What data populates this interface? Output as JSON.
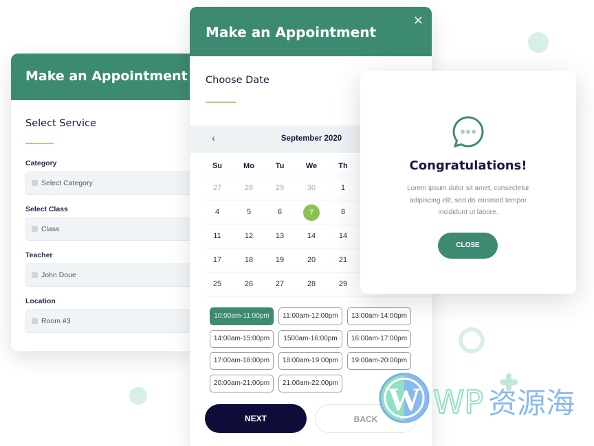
{
  "colors": {
    "primary": "#3d8a72",
    "accent": "#8cc151",
    "dark": "#0f0c3a"
  },
  "service_form": {
    "title": "Make an Appointment",
    "subtitle": "Select Service",
    "fields": [
      {
        "label": "Category",
        "value": "Select Category",
        "icon": "category-icon"
      },
      {
        "label": "Select Class",
        "value": "Class",
        "icon": "class-icon"
      },
      {
        "label": "Teacher",
        "value": "John Doue",
        "icon": "user-icon"
      },
      {
        "label": "Location",
        "value": "Room #3",
        "icon": "location-pin-icon"
      }
    ]
  },
  "date_form": {
    "title": "Make an Appointment",
    "close": "×",
    "subtitle": "Choose Date",
    "prev": "‹",
    "month": "September 2020",
    "weekdays": [
      "Su",
      "Mo",
      "Tu",
      "We",
      "Th"
    ],
    "weeks": [
      [
        "27",
        "28",
        "29",
        "30",
        "1"
      ],
      [
        "4",
        "5",
        "6",
        "7",
        "8"
      ],
      [
        "11",
        "12",
        "13",
        "14",
        "14"
      ],
      [
        "17",
        "18",
        "19",
        "20",
        "21"
      ],
      [
        "25",
        "26",
        "27",
        "28",
        "29"
      ]
    ],
    "selected_day": "7",
    "slots": [
      "10:00am-11:00pm",
      "11:00am-12:00pm",
      "13:00am-14:00pm",
      "14:00am-15:00pm",
      "1500am-16:00pm",
      "16:00am-17:00pm",
      "17:00am-18:00pm",
      "18:00am-19:00pm",
      "19:00am-20:00pm",
      "20:00am-21:00pm",
      "21:00am-22:00pm"
    ],
    "selected_slot": 0,
    "next": "NEXT",
    "back": "BACK"
  },
  "congrats": {
    "title": "Congratulations!",
    "text": "Lorem ipsum dolor sit amet, consectetur adipiscing elit, sed do eiusmod tempor incididunt ut labore.",
    "close": "CLOSE"
  },
  "watermark": "WP资源海"
}
